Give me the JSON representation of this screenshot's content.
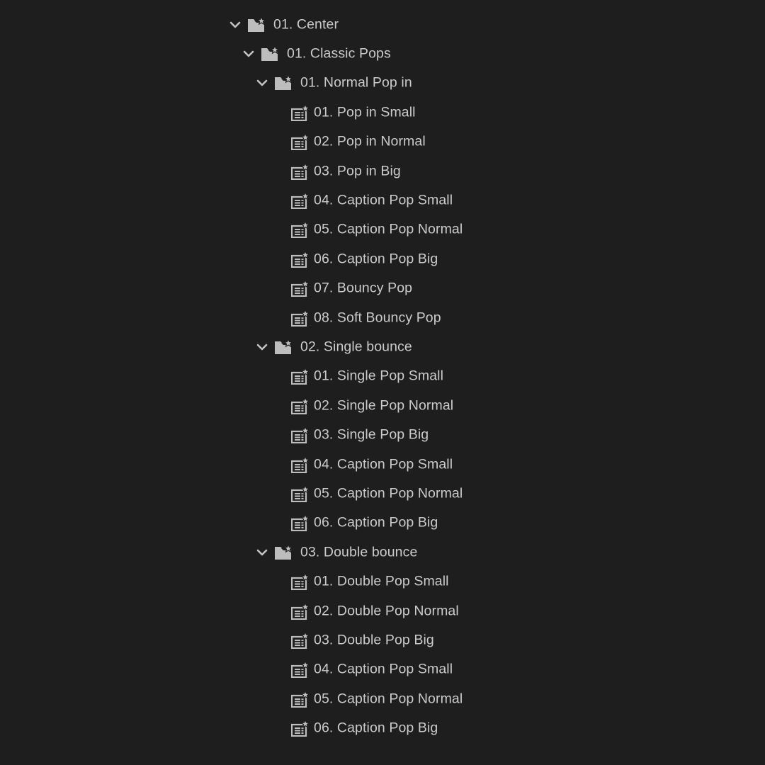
{
  "tree": {
    "root": {
      "label": "01. Center",
      "expanded": true,
      "icon": "folder-star-icon"
    },
    "classic_pops": {
      "label": "01. Classic Pops",
      "expanded": true,
      "icon": "folder-star-icon"
    },
    "normal_pop_in": {
      "label": "01. Normal Pop in",
      "expanded": true,
      "icon": "folder-star-icon",
      "items": [
        {
          "label": "01. Pop in Small",
          "icon": "preset-star-icon"
        },
        {
          "label": "02. Pop in Normal",
          "icon": "preset-star-icon"
        },
        {
          "label": "03. Pop in Big",
          "icon": "preset-star-icon"
        },
        {
          "label": "04. Caption Pop Small",
          "icon": "preset-star-icon"
        },
        {
          "label": "05. Caption Pop Normal",
          "icon": "preset-star-icon"
        },
        {
          "label": "06. Caption Pop Big",
          "icon": "preset-star-icon"
        },
        {
          "label": "07. Bouncy Pop",
          "icon": "preset-star-icon"
        },
        {
          "label": "08. Soft Bouncy Pop",
          "icon": "preset-star-icon"
        }
      ]
    },
    "single_bounce": {
      "label": "02. Single bounce",
      "expanded": true,
      "icon": "folder-star-icon",
      "items": [
        {
          "label": "01. Single Pop Small",
          "icon": "preset-star-icon"
        },
        {
          "label": "02. Single Pop Normal",
          "icon": "preset-star-icon"
        },
        {
          "label": "03. Single Pop Big",
          "icon": "preset-star-icon"
        },
        {
          "label": "04. Caption Pop Small",
          "icon": "preset-star-icon"
        },
        {
          "label": "05. Caption Pop Normal",
          "icon": "preset-star-icon"
        },
        {
          "label": "06. Caption Pop Big",
          "icon": "preset-star-icon"
        }
      ]
    },
    "double_bounce": {
      "label": "03. Double bounce",
      "expanded": true,
      "icon": "folder-star-icon",
      "items": [
        {
          "label": "01. Double Pop Small",
          "icon": "preset-star-icon"
        },
        {
          "label": "02. Double Pop Normal",
          "icon": "preset-star-icon"
        },
        {
          "label": "03. Double Pop Big",
          "icon": "preset-star-icon"
        },
        {
          "label": "04. Caption Pop Small",
          "icon": "preset-star-icon"
        },
        {
          "label": "05. Caption Pop Normal",
          "icon": "preset-star-icon"
        },
        {
          "label": "06. Caption Pop Big",
          "icon": "preset-star-icon"
        }
      ]
    }
  },
  "colors": {
    "background": "#1e1e1f",
    "text": "#cbcbcb",
    "icon": "#bdbdbd"
  }
}
